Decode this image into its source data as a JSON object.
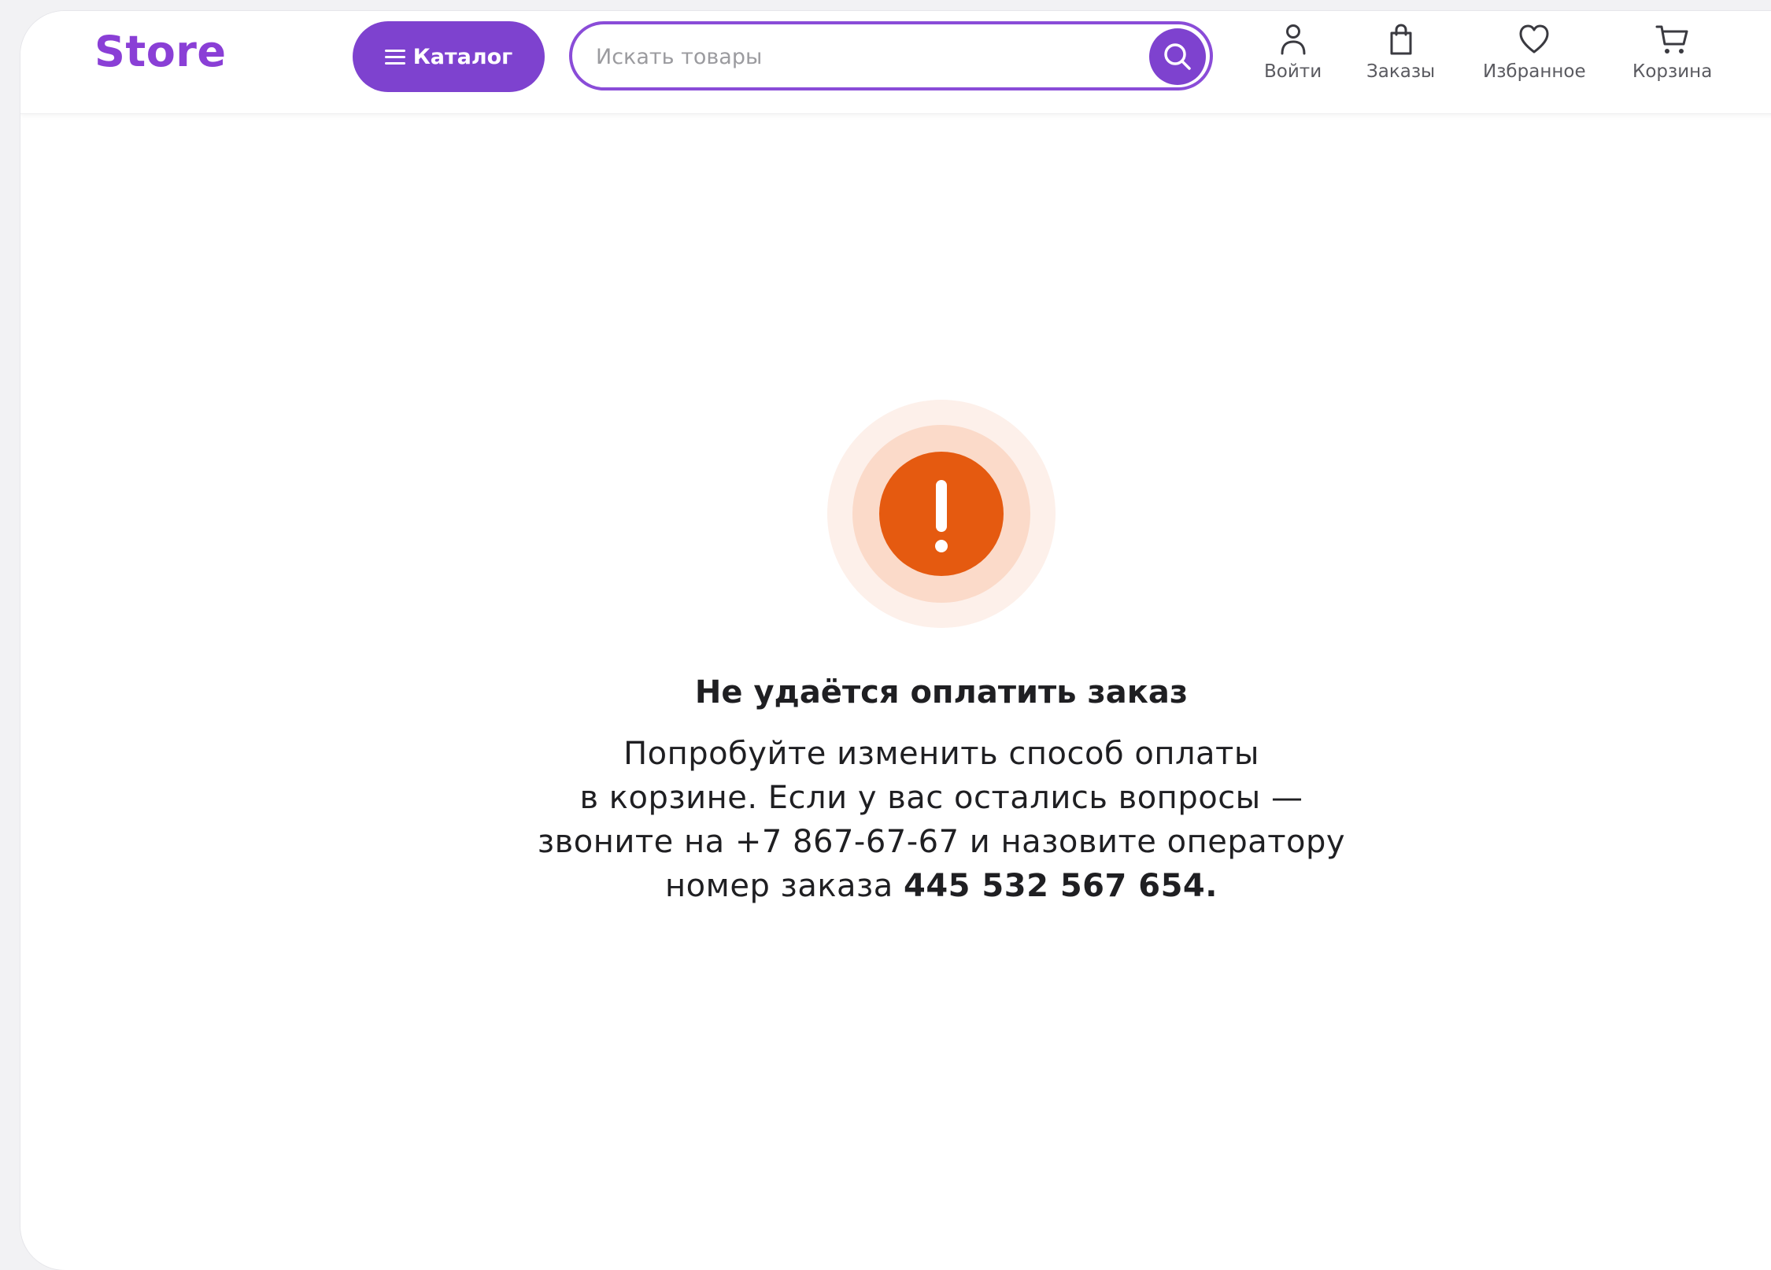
{
  "header": {
    "logo": "Store",
    "catalog_label": "Каталог",
    "search_placeholder": "Искать товары",
    "search_value": "",
    "nav": [
      {
        "label": "Войти",
        "icon": "user-icon"
      },
      {
        "label": "Заказы",
        "icon": "bag-icon"
      },
      {
        "label": "Избранное",
        "icon": "heart-icon"
      },
      {
        "label": "Корзина",
        "icon": "cart-icon"
      }
    ]
  },
  "error": {
    "icon": "alert-icon",
    "title": "Не удаётся оплатить заказ",
    "line1": "Попробуйте изменить способ оплаты",
    "line2": "в корзине. Если у вас остались вопросы —",
    "line3": "звоните на +7 867-67-67 и назовите оператору",
    "line4_prefix": "номер заказа ",
    "order_number": "445 532 567 654."
  },
  "colors": {
    "brand": "#7e42cf",
    "logo": "#8a3fd6",
    "alert": "#e55a10"
  }
}
